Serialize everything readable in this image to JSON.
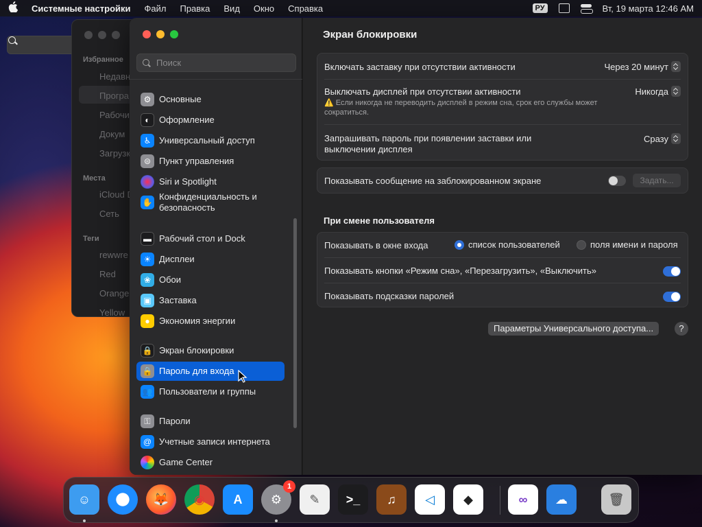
{
  "menubar": {
    "app_name": "Системные настройки",
    "menus": [
      "Файл",
      "Правка",
      "Вид",
      "Окно",
      "Справка"
    ],
    "lang": "РУ",
    "datetime": "Вт, 19 марта  12:46 AM"
  },
  "finder": {
    "sections": [
      {
        "title": "Избранное",
        "items": [
          "Недавн",
          "Програ",
          "Рабочий",
          "Докум",
          "Загрузк"
        ]
      },
      {
        "title": "Места",
        "items": [
          "iCloud D",
          "Сеть"
        ]
      },
      {
        "title": "Теги",
        "items": [
          "rewwre",
          "Red",
          "Orange",
          "Yellow"
        ]
      }
    ]
  },
  "sidebar": {
    "search_placeholder": "Поиск",
    "items": [
      {
        "label": "Основные",
        "icon": "gear-icon",
        "color": "#8e8e93"
      },
      {
        "label": "Оформление",
        "icon": "appearance-icon",
        "color": "#1c1c1e"
      },
      {
        "label": "Универсальный доступ",
        "icon": "accessibility-icon",
        "color": "#0a84ff"
      },
      {
        "label": "Пункт управления",
        "icon": "control-center-icon",
        "color": "#8e8e93"
      },
      {
        "label": "Siri и Spotlight",
        "icon": "siri-icon",
        "color": "#bf5af2"
      },
      {
        "label": "Конфиденциальность и безопасность",
        "icon": "hand-icon",
        "color": "#0a84ff"
      },
      {
        "label": "Рабочий стол и Dock",
        "icon": "dock-icon",
        "color": "#1c1c1e"
      },
      {
        "label": "Дисплеи",
        "icon": "display-icon",
        "color": "#0a84ff"
      },
      {
        "label": "Обои",
        "icon": "wallpaper-icon",
        "color": "#32ade6"
      },
      {
        "label": "Заставка",
        "icon": "screensaver-icon",
        "color": "#5ac8fa"
      },
      {
        "label": "Экономия энергии",
        "icon": "bulb-icon",
        "color": "#ffcc00"
      },
      {
        "label": "Экран блокировки",
        "icon": "lock-screen-icon",
        "color": "#1c1c1e"
      },
      {
        "label": "Пароль для входа",
        "icon": "lock-icon",
        "color": "#8e8e93"
      },
      {
        "label": "Пользователи и группы",
        "icon": "users-icon",
        "color": "#0a84ff"
      },
      {
        "label": "Пароли",
        "icon": "key-icon",
        "color": "#8e8e93"
      },
      {
        "label": "Учетные записи интернета",
        "icon": "at-icon",
        "color": "#0a84ff"
      },
      {
        "label": "Game Center",
        "icon": "game-center-icon",
        "color": "#ffffff"
      }
    ],
    "active_index": 12
  },
  "content": {
    "title": "Экран блокировки",
    "group1": {
      "row1": {
        "label": "Включать заставку при отсутствии активности",
        "value": "Через 20 минут"
      },
      "row2": {
        "label": "Выключать дисплей при отсутствии активности",
        "value": "Никогда",
        "note_icon": "⚠️",
        "note": "Если никогда не переводить дисплей в режим сна, срок его службы может сократиться."
      },
      "row3": {
        "label": "Запрашивать пароль при появлении заставки или выключении дисплея",
        "value": "Сразу"
      }
    },
    "group2": {
      "label": "Показывать сообщение на заблокированном экране",
      "toggle": false,
      "button": "Задать..."
    },
    "section_title": "При смене пользователя",
    "group3": {
      "row1": {
        "label": "Показывать в окне входа",
        "option1": "список пользователей",
        "option2": "поля имени и пароля",
        "selected": "option1"
      },
      "row2": {
        "label": "Показывать кнопки «Режим сна», «Перезагрузить», «Выключить»",
        "toggle": true
      },
      "row3": {
        "label": "Показывать подсказки паролей",
        "toggle": true
      }
    },
    "accessibility_button": "Параметры Универсального доступа...",
    "help_button": "?"
  },
  "dock": {
    "apps": [
      {
        "name": "Finder",
        "icon": "finder-icon",
        "color": "#3d9cf0",
        "running": true
      },
      {
        "name": "Safari",
        "icon": "safari-icon",
        "color": "#1e8cff",
        "running": false
      },
      {
        "name": "Firefox",
        "icon": "firefox-icon",
        "color": "#ff7139",
        "running": false
      },
      {
        "name": "Chrome",
        "icon": "chrome-icon",
        "color": "#e8e8e8",
        "running": false
      },
      {
        "name": "App Store",
        "icon": "app-store-icon",
        "color": "#1a8cff",
        "running": false
      },
      {
        "name": "Системные настройки",
        "icon": "system-settings-icon",
        "color": "#8e8e93",
        "running": true,
        "badge": "1"
      },
      {
        "name": "TextEdit",
        "icon": "textedit-icon",
        "color": "#f0f0f0",
        "running": false
      },
      {
        "name": "Terminal",
        "icon": "terminal-icon",
        "color": "#1c1c1e",
        "running": false
      },
      {
        "name": "GarageBand",
        "icon": "guitar-icon",
        "color": "#8a4a1a",
        "running": false
      },
      {
        "name": "VS Code",
        "icon": "vscode-icon",
        "color": "#ffffff",
        "running": false
      },
      {
        "name": "Roblox",
        "icon": "roblox-icon",
        "color": "#ffffff",
        "running": false
      },
      {
        "name": "Visual Studio",
        "icon": "visual-studio-icon",
        "color": "#ffffff",
        "running": false
      },
      {
        "name": "Weather",
        "icon": "weather-icon",
        "color": "#2a7fe0",
        "running": false
      },
      {
        "name": "Trash",
        "icon": "trash-icon",
        "color": "#c8c8c8",
        "running": false
      }
    ]
  }
}
